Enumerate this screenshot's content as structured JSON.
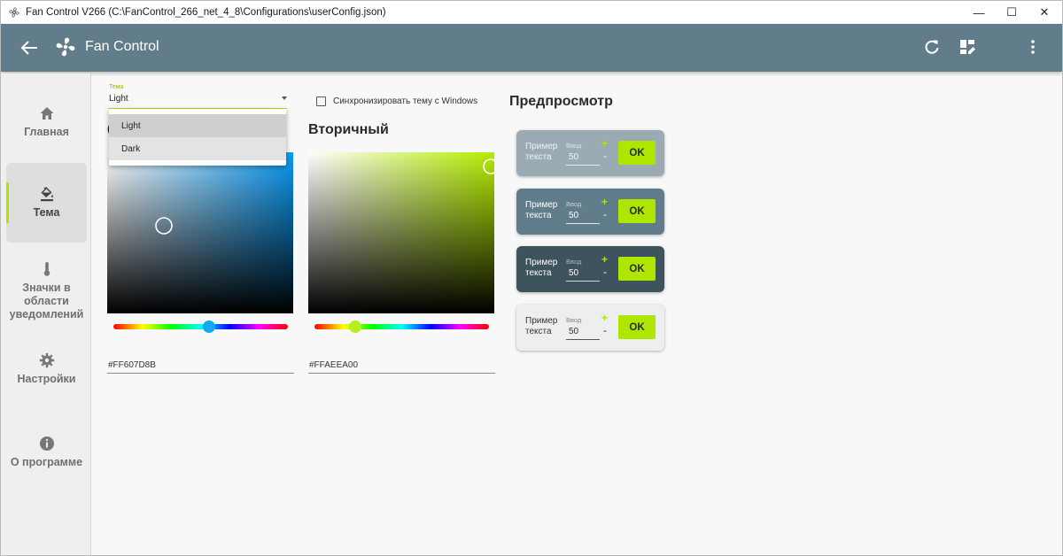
{
  "window": {
    "title": "Fan Control V266 (C:\\FanControl_266_net_4_8\\Configurations\\userConfig.json)",
    "controls": [
      "—",
      "☐",
      "✕"
    ]
  },
  "appbar": {
    "title": "Fan Control",
    "icons": [
      "back-arrow-icon",
      "fan-icon",
      "refresh-icon",
      "dashboard-edit-icon",
      "more-vert-icon"
    ]
  },
  "sidebar": {
    "items": [
      {
        "label": "Главная",
        "icon": "home-icon",
        "active": false
      },
      {
        "label": "Тема",
        "icon": "paint-bucket-icon",
        "active": true
      },
      {
        "label": "Значки в области уведомлений",
        "icon": "thermometer-icon",
        "active": false
      },
      {
        "label": "Настройки",
        "icon": "gear-icon",
        "active": false
      },
      {
        "label": "О программе",
        "icon": "info-icon",
        "active": false
      }
    ]
  },
  "theme": {
    "field_label": "Тема",
    "value": "Light",
    "options": [
      "Light",
      "Dark"
    ],
    "sync_label": "Синхронизировать тему с Windows",
    "sync_checked": false
  },
  "primary": {
    "hex": "#FF607D8B",
    "color": "#607D8B"
  },
  "secondary": {
    "title": "Вторичный",
    "hex": "#FFAEEA00",
    "color": "#AEEA00"
  },
  "preview": {
    "title": "Предпросмотр",
    "cards": [
      {
        "text": "Пример текста",
        "label": "Ввод",
        "value": "50",
        "plus": "+",
        "minus": "-",
        "button": "OK",
        "bg": "#9aabb4"
      },
      {
        "text": "Пример текста",
        "label": "Ввод",
        "value": "50",
        "plus": "+",
        "minus": "-",
        "button": "OK",
        "bg": "#617d8b"
      },
      {
        "text": "Пример текста",
        "label": "Ввод",
        "value": "50",
        "plus": "+",
        "minus": "-",
        "button": "OK",
        "bg": "#3d535d"
      },
      {
        "text": "Пример текста",
        "label": "Ввод",
        "value": "50",
        "plus": "+",
        "minus": "-",
        "button": "OK",
        "bg": "#eceeef"
      }
    ]
  },
  "colors": {
    "appbar": "#617d8b",
    "accent": "#aee600"
  }
}
